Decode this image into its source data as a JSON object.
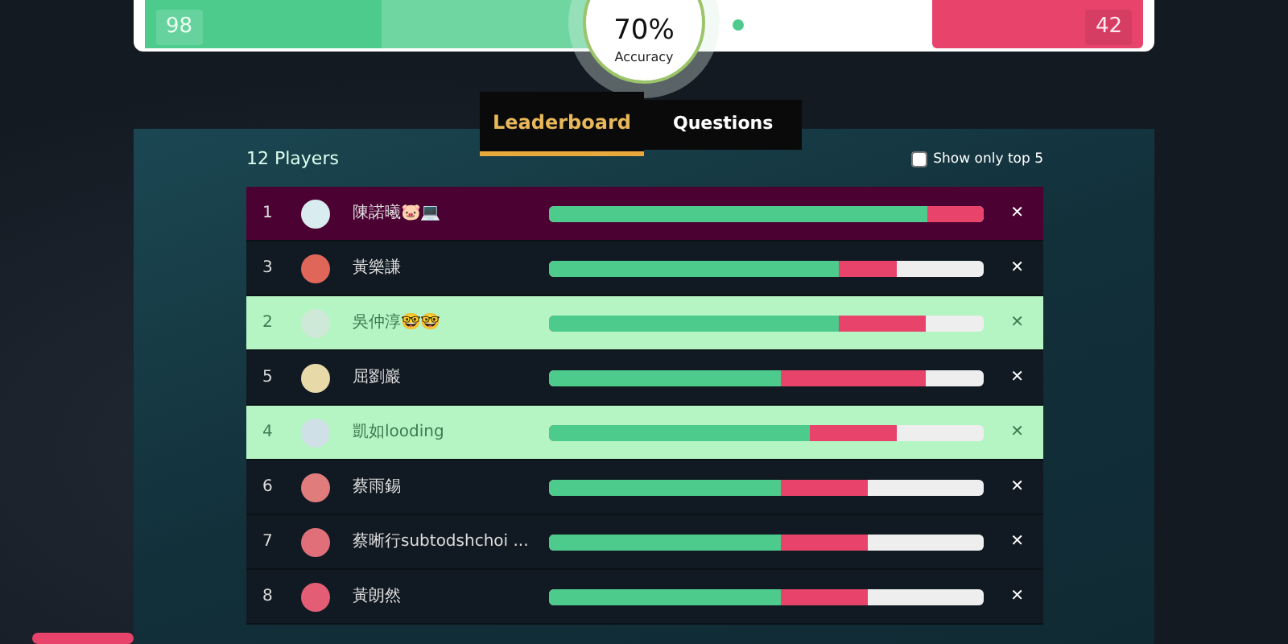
{
  "summary": {
    "correct": "98",
    "correct_bar": {
      "level": 0.48
    },
    "accuracy": "70%",
    "accuracy_label": "Accuracy",
    "incorrect": "42"
  },
  "tabs": [
    {
      "label": "Leaderboard",
      "selected": true
    },
    {
      "label": "Questions",
      "selected": false
    }
  ],
  "players_count": "12 Players",
  "top5_filter": {
    "label": "Show only top 5",
    "checked": false
  },
  "rows": [
    {
      "rank": "1",
      "name": "陳諾曦🐷💻",
      "kind": "own",
      "correct": {
        "level": 0.87
      },
      "answered": {
        "level": 1.0
      },
      "remove": "✕"
    },
    {
      "rank": "3",
      "name": "黃樂謙",
      "kind": "plain",
      "correct": {
        "level": 0.667
      },
      "answered": {
        "level": 0.8
      },
      "remove": "✕"
    },
    {
      "rank": "2",
      "name": "吳仲淳🤓🤓",
      "kind": "recent",
      "correct": {
        "level": 0.667
      },
      "answered": {
        "level": 0.867
      },
      "remove": "✕"
    },
    {
      "rank": "5",
      "name": "屈劉巖",
      "kind": "plain",
      "correct": {
        "level": 0.533
      },
      "answered": {
        "level": 0.867
      },
      "remove": "✕"
    },
    {
      "rank": "4",
      "name": "凱如looding",
      "kind": "recent",
      "correct": {
        "level": 0.6
      },
      "answered": {
        "level": 0.8
      },
      "remove": "✕"
    },
    {
      "rank": "6",
      "name": "蔡雨錫",
      "kind": "plain",
      "correct": {
        "level": 0.533
      },
      "answered": {
        "level": 0.733
      },
      "remove": "✕"
    },
    {
      "rank": "7",
      "name": "蔡晰行subtodshchoi ...",
      "kind": "plain",
      "correct": {
        "level": 0.533
      },
      "answered": {
        "level": 0.733
      },
      "remove": "✕"
    },
    {
      "rank": "8",
      "name": "黃朗然",
      "kind": "plain",
      "correct": {
        "level": 0.533
      },
      "answered": {
        "level": 0.733
      },
      "remove": "✕"
    }
  ]
}
